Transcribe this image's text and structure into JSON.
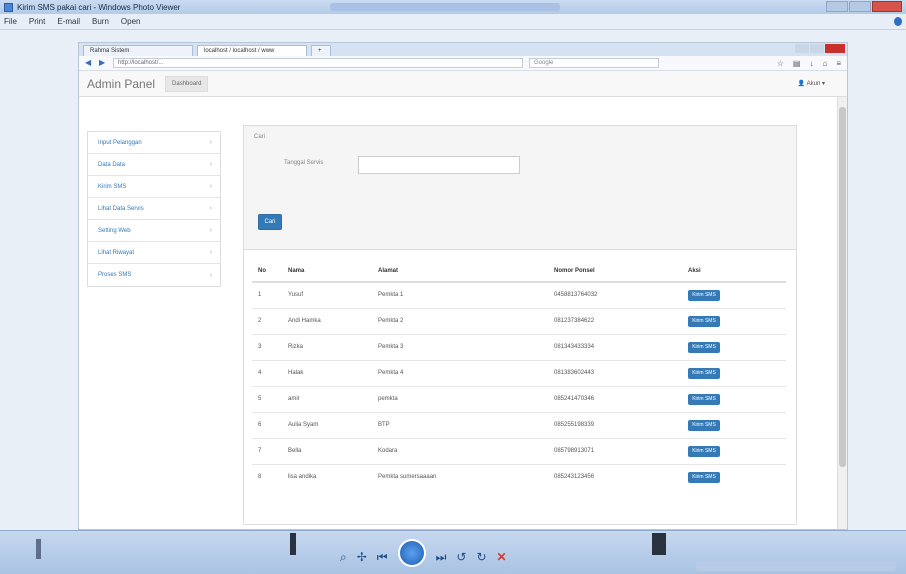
{
  "viewer": {
    "title": "Kirim SMS pakai cari - Windows Photo Viewer",
    "menu": [
      "File",
      "Print",
      "E-mail",
      "Burn",
      "Open"
    ]
  },
  "browser": {
    "tabs": [
      "Rahma Sistem",
      "localhost / localhost / www"
    ],
    "url": "http://localhost/...",
    "search_placeholder": "Google"
  },
  "navbar": {
    "brand": "Admin Panel",
    "dashboard": "Dashboard",
    "user": "Akun"
  },
  "sidebar": {
    "items": [
      {
        "label": "Input Pelanggan"
      },
      {
        "label": "Data Data"
      },
      {
        "label": "Kirim SMS"
      },
      {
        "label": "Lihat Data Servis"
      },
      {
        "label": "Setting Web"
      },
      {
        "label": "Lihat Riwayat"
      },
      {
        "label": "Proses SMS"
      }
    ]
  },
  "filter": {
    "heading": "Cari",
    "label": "Tanggal Servis",
    "button": "Cari"
  },
  "table": {
    "headers": [
      "No",
      "Nama",
      "Alamat",
      "Nomor Ponsel",
      "Aksi"
    ],
    "action_label": "Kirim SMS",
    "rows": [
      {
        "no": "1",
        "nama": "Yusuf",
        "alamat": "Pemkta 1",
        "ponsel": "0458813764032"
      },
      {
        "no": "2",
        "nama": "Andi Hamka",
        "alamat": "Pemkta 2",
        "ponsel": "081237384622"
      },
      {
        "no": "3",
        "nama": "Rizka",
        "alamat": "Pemkta 3",
        "ponsel": "081343433334"
      },
      {
        "no": "4",
        "nama": "Halak",
        "alamat": "Pemkta 4",
        "ponsel": "081383602443"
      },
      {
        "no": "5",
        "nama": "amir",
        "alamat": "pemkta",
        "ponsel": "085241470346"
      },
      {
        "no": "6",
        "nama": "Aulia Syam",
        "alamat": "BTP",
        "ponsel": "085255198339"
      },
      {
        "no": "7",
        "nama": "Bella",
        "alamat": "Kodara",
        "ponsel": "085798913071"
      },
      {
        "no": "8",
        "nama": "lisa andika",
        "alamat": "Pemkta sumersaaaan",
        "ponsel": "085243123456"
      }
    ]
  }
}
